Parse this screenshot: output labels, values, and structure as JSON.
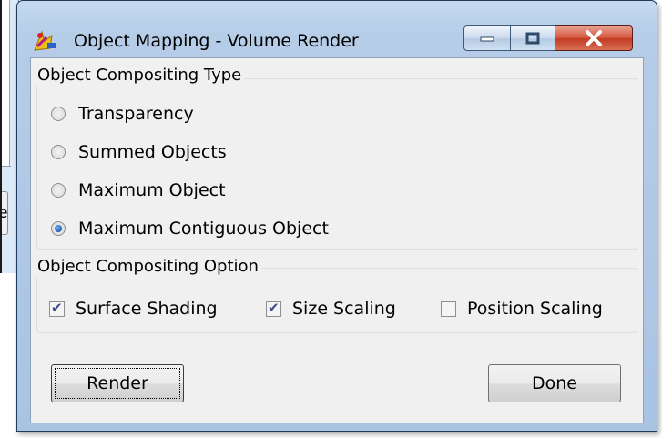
{
  "window": {
    "title": "Object Mapping - Volume Render",
    "controls": {
      "minimize": "minimize",
      "maximize": "maximize",
      "close": "close"
    }
  },
  "background_window": {
    "button_fragment": "e"
  },
  "compositing_type": {
    "title": "Object Compositing Type",
    "options": [
      {
        "label": "Transparency",
        "selected": false
      },
      {
        "label": "Summed Objects",
        "selected": false
      },
      {
        "label": "Maximum Object",
        "selected": false
      },
      {
        "label": "Maximum Contiguous Object",
        "selected": true
      }
    ]
  },
  "compositing_option": {
    "title": "Object Compositing Option",
    "options": [
      {
        "label": "Surface Shading",
        "checked": true
      },
      {
        "label": "Size Scaling",
        "checked": true
      },
      {
        "label": "Position Scaling",
        "checked": false
      }
    ]
  },
  "buttons": {
    "render": "Render",
    "done": "Done"
  },
  "colors": {
    "title_gradient": "#b6cde8",
    "close_button": "#c23b22",
    "client_bg": "#f0f0f0",
    "radio_dot": "#1d5fb5"
  }
}
